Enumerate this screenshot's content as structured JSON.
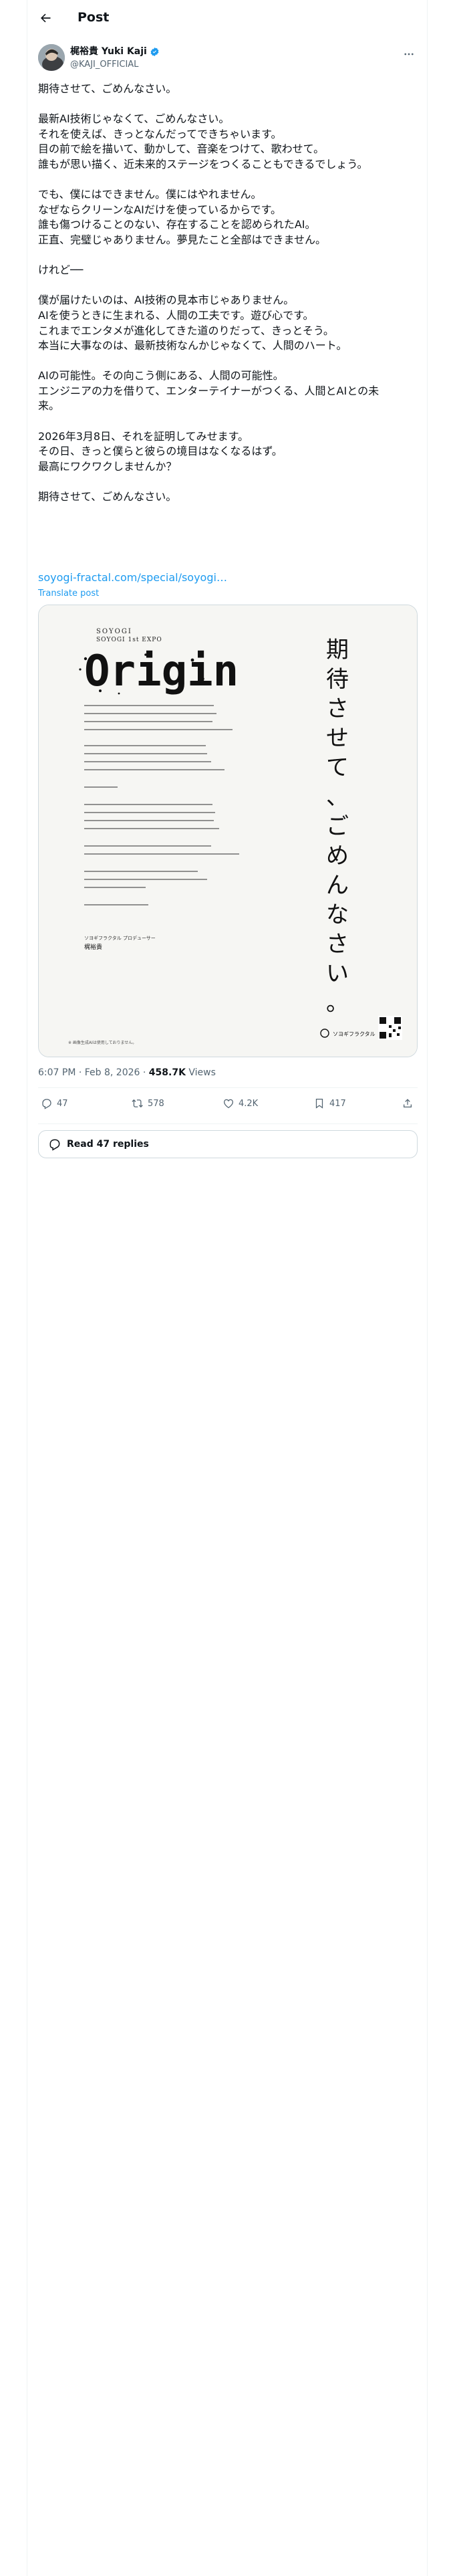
{
  "header": {
    "title": "Post"
  },
  "author": {
    "name": "梶裕貴 Yuki Kaji",
    "handle": "@KAJI_OFFICIAL"
  },
  "tweet": {
    "paragraphs": [
      [
        "期待させて、ごめんなさい。"
      ],
      [
        "最新AI技術じゃなくて、ごめんなさい。",
        "それを使えば、きっとなんだってできちゃいます。",
        "目の前で絵を描いて、動かして、音楽をつけて、歌わせて。",
        "誰もが思い描く、近未来的ステージをつくることもできるでしょう。"
      ],
      [
        "でも、僕にはできません。僕にはやれません。",
        "なぜならクリーンなAIだけを使っているからです。",
        "誰も傷つけることのない、存在することを認められたAI。",
        "正直、完璧じゃありません。夢見たこと全部はできません。"
      ],
      [
        "けれど──"
      ],
      [
        "僕が届けたいのは、AI技術の見本市じゃありません。",
        "AIを使うときに生まれる、人間の工夫です。遊び心です。",
        "これまでエンタメが進化してきた道のりだって、きっとそう。",
        "本当に大事なのは、最新技術なんかじゃなくて、人間のハート。"
      ],
      [
        "AIの可能性。その向こう側にある、人間の可能性。",
        "エンジニアの力を借りて、エンターテイナーがつくる、人間とAIとの未",
        "来。"
      ],
      [
        "2026年3月8日、それを証明してみせます。",
        "その日、きっと僕らと彼らの境目はなくなるはず。",
        "最高にワクワクしませんか？"
      ],
      [
        "期待させて、ごめんなさい。"
      ]
    ],
    "link": "soyogi-fractal.com/special/soyogi…",
    "translate": "Translate post"
  },
  "poster": {
    "brand": "SOYOGI",
    "brand2": "SOYOGI   1st EXPO",
    "logo": "Origin",
    "vertical_headline": "期待させて、ごめんなさい。",
    "signature_role": "ソヨギフラクタル プロデューサー",
    "signature_name": "梶裕貴",
    "footer": "ソヨギフラクタル",
    "footnote": "※ 画像生成AIは使用しておりません。"
  },
  "meta": {
    "time": "6:07 PM · Feb 8, 2026 · ",
    "views_num": "458.7K",
    "views_label": " Views"
  },
  "actions": {
    "replies": "47",
    "reposts": "578",
    "likes": "4.2K",
    "bookmarks": "417"
  },
  "read_replies": "Read 47 replies",
  "colors": {
    "accent": "#1d9bf0",
    "muted": "#536471",
    "text": "#0f1419",
    "border": "#cfd9de"
  },
  "icons": [
    "back-arrow-icon",
    "verified-badge-icon",
    "more-icon",
    "reply-icon",
    "repost-icon",
    "like-icon",
    "bookmark-icon",
    "share-icon",
    "speech-bubble-icon"
  ]
}
